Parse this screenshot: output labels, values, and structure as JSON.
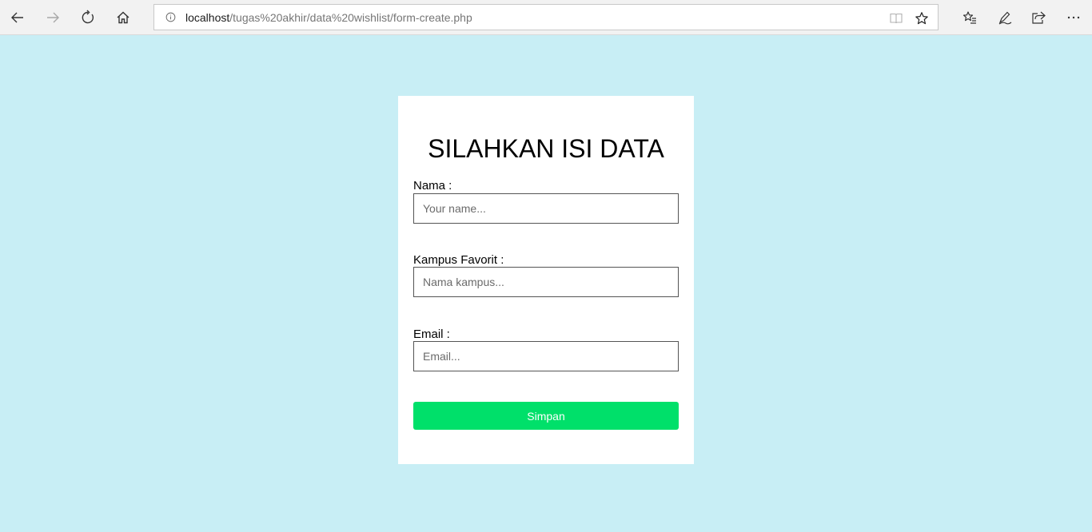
{
  "browser": {
    "url_host": "localhost",
    "url_path": "/tugas%20akhir/data%20wishlist/form-create.php",
    "icons": {
      "back": "back-arrow-icon",
      "forward": "forward-arrow-icon",
      "refresh": "refresh-icon",
      "home": "home-icon",
      "info": "info-icon",
      "reading_view": "reading-view-icon",
      "favorite": "star-icon",
      "favorites_hub": "favorites-list-icon",
      "notes": "pen-icon",
      "share": "share-icon",
      "more": "more-dots-icon"
    }
  },
  "form": {
    "title": "SILAHKAN ISI DATA",
    "fields": [
      {
        "label": "Nama :",
        "placeholder": "Your name...",
        "value": ""
      },
      {
        "label": "Kampus Favorit :",
        "placeholder": "Nama kampus...",
        "value": ""
      },
      {
        "label": "Email :",
        "placeholder": "Email...",
        "value": ""
      }
    ],
    "submit_label": "Simpan"
  },
  "colors": {
    "page_background": "#c8eef5",
    "card_background": "#ffffff",
    "button_background": "#00e06a",
    "button_text": "#ffffff"
  }
}
